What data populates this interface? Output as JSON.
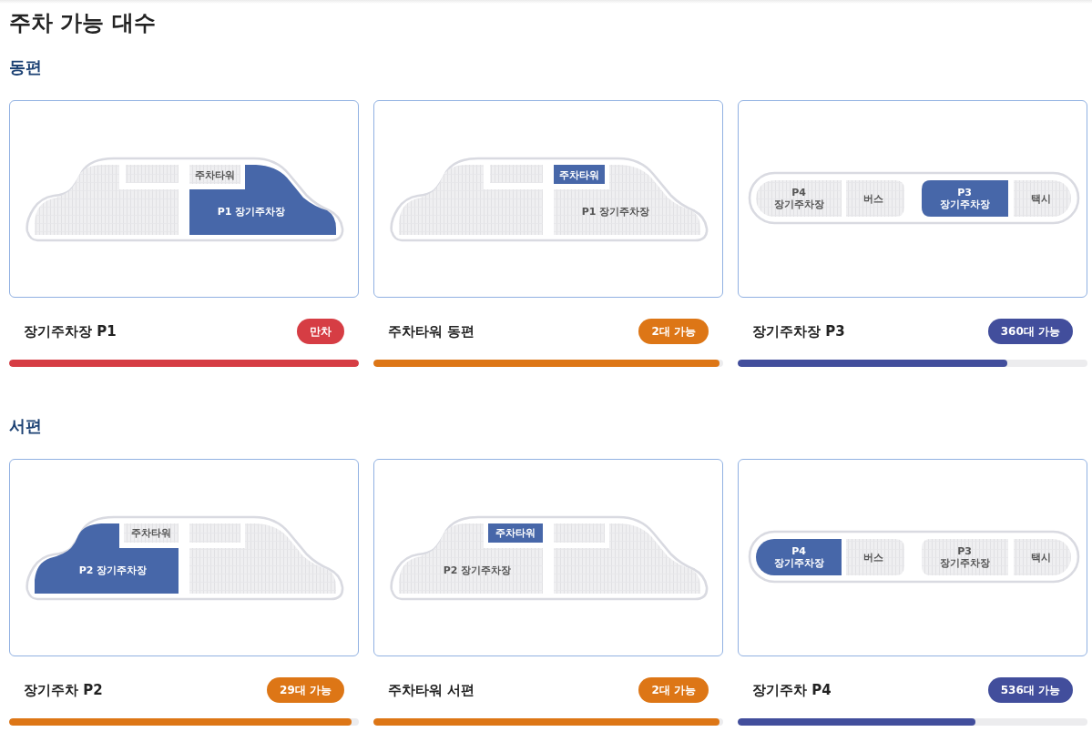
{
  "title": "주차 가능 대수",
  "sections": [
    {
      "heading": "동편",
      "lots": [
        {
          "name": "장기주차장 P1",
          "status": "만차",
          "color": "#d63d44",
          "level": 1,
          "map": {
            "kind": "car",
            "mirrored": false,
            "zones": [
              {
                "kind": "tower",
                "label": "주차타워",
                "selected": false
              },
              {
                "kind": "lot",
                "label": "P1 장기주차장",
                "selected": true
              }
            ]
          }
        },
        {
          "name": "주차타워 동편",
          "status": "2대 가능",
          "color": "#dd7616",
          "level": 0.99,
          "map": {
            "kind": "car",
            "mirrored": false,
            "zones": [
              {
                "kind": "tower",
                "label": "주차타워",
                "selected": true
              },
              {
                "kind": "lot",
                "label": "P1 장기주차장",
                "selected": false
              }
            ]
          }
        },
        {
          "name": "장기주차장 P3",
          "status": "360대 가능",
          "color": "#424e9c",
          "level": 0.77,
          "map": {
            "kind": "capsule",
            "zones": [
              {
                "label": "P4 장기주차장",
                "selected": false
              },
              {
                "label": "버스",
                "selected": false
              },
              {
                "label": "P3 장기주차장",
                "selected": true
              },
              {
                "label": "택시",
                "selected": false
              }
            ]
          }
        }
      ]
    },
    {
      "heading": "서편",
      "lots": [
        {
          "name": "장기주차 P2",
          "status": "29대 가능",
          "color": "#dd7616",
          "level": 0.98,
          "map": {
            "kind": "car",
            "mirrored": true,
            "zones": [
              {
                "kind": "tower",
                "label": "주차타워",
                "selected": false
              },
              {
                "kind": "lot",
                "label": "P2 장기주차장",
                "selected": true
              }
            ]
          }
        },
        {
          "name": "주차타워 서편",
          "status": "2대 가능",
          "color": "#dd7616",
          "level": 0.99,
          "map": {
            "kind": "car",
            "mirrored": true,
            "zones": [
              {
                "kind": "tower",
                "label": "주차타워",
                "selected": true
              },
              {
                "kind": "lot",
                "label": "P2 장기주차장",
                "selected": false
              }
            ]
          }
        },
        {
          "name": "장기주차 P4",
          "status": "536대 가능",
          "color": "#424e9c",
          "level": 0.68,
          "map": {
            "kind": "capsule",
            "zones": [
              {
                "label": "P4 장기주차장",
                "selected": true
              },
              {
                "label": "버스",
                "selected": false
              },
              {
                "label": "P3 장기주차장",
                "selected": false
              },
              {
                "label": "택시",
                "selected": false
              }
            ]
          }
        }
      ]
    }
  ]
}
